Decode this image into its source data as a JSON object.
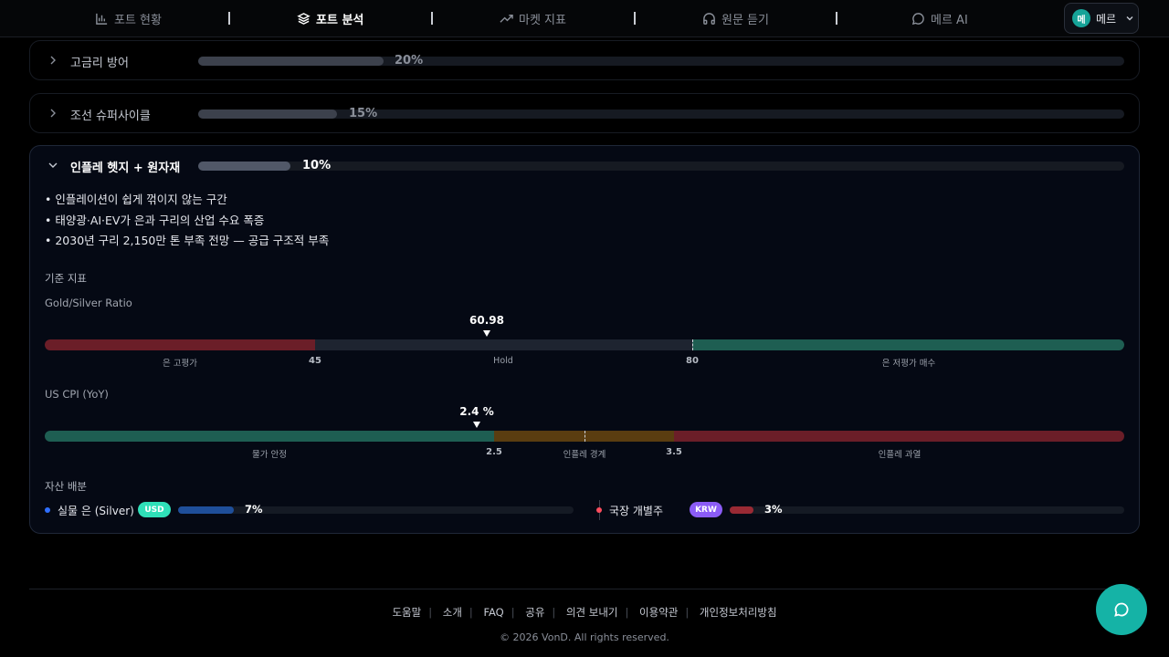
{
  "nav": {
    "items": [
      {
        "label": "포트 현황",
        "icon": "bar-chart-icon"
      },
      {
        "label": "포트 분석",
        "icon": "layers-icon"
      },
      {
        "label": "마켓 지표",
        "icon": "trend-up-icon"
      },
      {
        "label": "원문 듣기",
        "icon": "headphones-icon"
      },
      {
        "label": "메르 AI",
        "icon": "chat-bubble-icon"
      }
    ],
    "active": "포트 분석",
    "user": {
      "avatar_text": "메",
      "name": "메르"
    }
  },
  "cards": [
    {
      "title": "고금리 방어",
      "percent_label": "20%",
      "percent": 20,
      "expanded": false
    },
    {
      "title": "조선 슈퍼사이클",
      "percent_label": "15%",
      "percent": 15,
      "expanded": false
    },
    {
      "title": "인플레 헷지 + 원자재",
      "percent_label": "10%",
      "percent": 10,
      "expanded": true
    }
  ],
  "detail": {
    "bullets": [
      "• 인플레이션이 쉽게 꺾이지 않는 구간",
      "• 태양광·AI·EV가 은과 구리의 산업 수요 폭증",
      "• 2030년 구리 2,150만 톤 부족 전망 — 공급 구조적 부족"
    ],
    "indicators_label": "기준 지표",
    "indicators": [
      {
        "name": "Gold/Silver Ratio",
        "value_label": "60.98",
        "value": 60.98,
        "min": 20,
        "max": 120,
        "thresholds": [
          45,
          80
        ],
        "threshold_labels": [
          "45",
          "80"
        ],
        "zone_labels": [
          "은 고평가",
          "Hold",
          "은 저평가 매수"
        ],
        "zone_colors": [
          "#6b1e28",
          "#1e2430",
          "#1e5e52"
        ]
      },
      {
        "name": "US CPI (YoY)",
        "value_label": "2.4 %",
        "value": 2.4,
        "min": 0,
        "max": 6,
        "thresholds": [
          2.5,
          3.5
        ],
        "threshold_labels": [
          "2.5",
          "3.5"
        ],
        "zone_labels": [
          "물가 안정",
          "인플레 경계",
          "인플레 과열"
        ],
        "zone_colors": [
          "#1e5e52",
          "#5a3d10",
          "#6b1e28"
        ]
      }
    ],
    "allocation_label": "자산 배분",
    "allocations": [
      {
        "name": "실물 은 (Silver)",
        "badge": "USD",
        "badge_color": "#2fe0b8",
        "dot_color": "#2f6fff",
        "fill_color": "#1f4f9a",
        "percent_label": "7%",
        "percent": 7
      },
      {
        "name": "국장 개별주",
        "badge": "KRW",
        "badge_color": "#8b5cf6",
        "dot_color": "#ff4d5e",
        "fill_color": "#9a2a34",
        "percent_label": "3%",
        "percent": 3
      }
    ]
  },
  "footer": {
    "links": [
      "도움말",
      "소개",
      "FAQ",
      "공유",
      "의견 보내기",
      "이용약관",
      "개인정보처리방침"
    ],
    "copyright": "© 2026 VonD. All rights reserved."
  }
}
